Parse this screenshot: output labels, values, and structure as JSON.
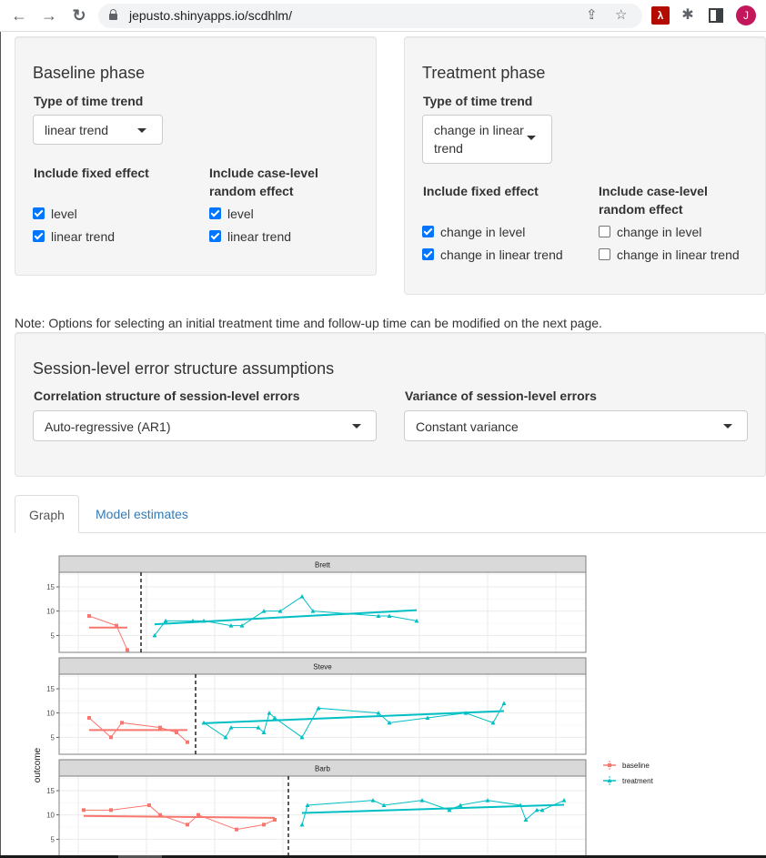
{
  "browser": {
    "url": "jepusto.shinyapps.io/scdhlm/",
    "avatar_initial": "J",
    "icons": [
      "back-arrow-icon",
      "forward-arrow-icon",
      "reload-icon",
      "lock-icon",
      "share-icon",
      "star-icon",
      "pdf-extension-icon",
      "puzzle-extensions-icon",
      "side-panel-icon",
      "profile-avatar"
    ]
  },
  "baseline": {
    "title": "Baseline phase",
    "trend_label": "Type of time trend",
    "trend_value": "linear trend",
    "fixed_label": "Include fixed effect",
    "random_label": "Include case-level random effect",
    "fixed_options": [
      {
        "label": "level",
        "checked": true
      },
      {
        "label": "linear trend",
        "checked": true
      }
    ],
    "random_options": [
      {
        "label": "level",
        "checked": true
      },
      {
        "label": "linear trend",
        "checked": true
      }
    ]
  },
  "treatment": {
    "title": "Treatment phase",
    "trend_label": "Type of time trend",
    "trend_value": "change in linear trend",
    "fixed_label": "Include fixed effect",
    "random_label": "Include case-level random effect",
    "fixed_options": [
      {
        "label": "change in level",
        "checked": true
      },
      {
        "label": "change in linear trend",
        "checked": true
      }
    ],
    "random_options": [
      {
        "label": "change in level",
        "checked": false
      },
      {
        "label": "change in linear trend",
        "checked": false
      }
    ]
  },
  "note": "Note: Options for selecting an initial treatment time and follow-up time can be modified on the next page.",
  "session": {
    "title": "Session-level error structure assumptions",
    "corr_label": "Correlation structure of session-level errors",
    "corr_value": "Auto-regressive (AR1)",
    "var_label": "Variance of session-level errors",
    "var_value": "Constant variance"
  },
  "tabs": [
    {
      "label": "Graph",
      "active": true
    },
    {
      "label": "Model estimates",
      "active": false
    }
  ],
  "chart_data": {
    "type": "line",
    "ylabel": "outcome",
    "xlabel": "",
    "yticks": [
      5,
      10,
      15
    ],
    "ylim": [
      1.5,
      18
    ],
    "xlim": [
      -3.5,
      93
    ],
    "grid": true,
    "legend": {
      "position": "right",
      "entries": [
        {
          "name": "baseline",
          "color": "#F8766D",
          "marker": "circle"
        },
        {
          "name": "treatment",
          "color": "#00BFC4",
          "marker": "triangle"
        }
      ]
    },
    "panels": [
      {
        "name": "Brett",
        "phase_change": 11.5,
        "baseline": {
          "x": [
            2,
            7,
            9
          ],
          "y": [
            9,
            7,
            2
          ]
        },
        "baseline_trend": {
          "x": [
            2,
            9
          ],
          "y": [
            6.6,
            6.6
          ]
        },
        "treatment": {
          "x": [
            14,
            16,
            21,
            23,
            28,
            30,
            34,
            37,
            41,
            43,
            55,
            57,
            62
          ],
          "y": [
            5,
            8,
            8,
            8,
            7,
            7,
            10,
            10,
            13,
            10,
            9,
            9,
            8
          ]
        },
        "treatment_trend": {
          "x": [
            14,
            62
          ],
          "y": [
            7.3,
            10.2
          ]
        }
      },
      {
        "name": "Steve",
        "phase_change": 21.5,
        "baseline": {
          "x": [
            2,
            6,
            8,
            15,
            18,
            20
          ],
          "y": [
            9,
            5,
            8,
            7,
            6,
            4
          ]
        },
        "baseline_trend": {
          "x": [
            2,
            20
          ],
          "y": [
            6.5,
            6.5
          ]
        },
        "treatment": {
          "x": [
            23,
            27,
            28,
            33,
            34,
            35,
            36,
            41,
            44,
            55,
            57,
            64,
            71,
            76,
            78
          ],
          "y": [
            8,
            5,
            7,
            7,
            6,
            10,
            9,
            5,
            11,
            10,
            8,
            9,
            10,
            8,
            12
          ]
        },
        "treatment_trend": {
          "x": [
            23,
            78
          ],
          "y": [
            7.9,
            10.4
          ]
        }
      },
      {
        "name": "Barb",
        "phase_change": 38.5,
        "baseline": {
          "x": [
            1,
            6,
            13,
            15,
            20,
            22,
            29,
            34,
            36
          ],
          "y": [
            11,
            11,
            12,
            10,
            8,
            10,
            7,
            8,
            9
          ]
        },
        "baseline_trend": {
          "x": [
            1,
            36
          ],
          "y": [
            9.8,
            9.4
          ]
        },
        "treatment": {
          "x": [
            41,
            42,
            54,
            56,
            63,
            68,
            70,
            75,
            81,
            82,
            84,
            85,
            89
          ],
          "y": [
            8,
            12,
            13,
            12,
            13,
            11,
            12,
            13,
            12,
            9,
            11,
            11,
            13
          ]
        },
        "treatment_trend": {
          "x": [
            41,
            89
          ],
          "y": [
            10.4,
            12.1
          ]
        }
      }
    ]
  }
}
